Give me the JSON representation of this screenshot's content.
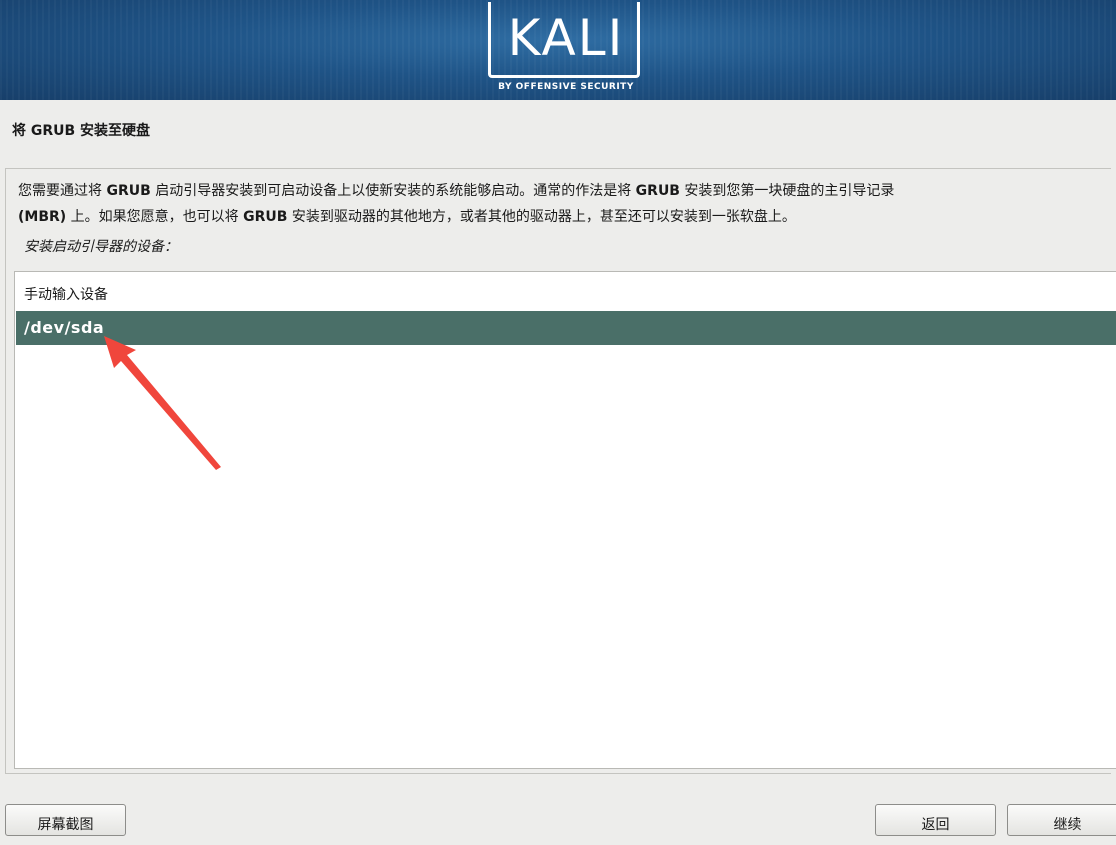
{
  "banner": {
    "logo_text": "KALI",
    "logo_subtitle": "BY OFFENSIVE SECURITY"
  },
  "step": {
    "title": "将 GRUB 安装至硬盘"
  },
  "description": {
    "line1_part1": "您需要通过将 ",
    "line1_bold1": "GRUB",
    "line1_part2": " 启动引导器安装到可启动设备上以使新安装的系统能够启动。通常的作法是将 ",
    "line1_bold2": "GRUB",
    "line1_part3": " 安装到您第一块硬盘的主引导记录",
    "line2_bold1": "(MBR)",
    "line2_part1": " 上。如果您愿意，也可以将 ",
    "line2_bold2": "GRUB",
    "line2_part2": " 安装到驱动器的其他地方，或者其他的驱动器上，甚至还可以安装到一张软盘上。"
  },
  "prompt": "安装启动引导器的设备：",
  "device_list": {
    "items": [
      {
        "label": "手动输入设备",
        "selected": false
      },
      {
        "label": "/dev/sda",
        "selected": true
      }
    ],
    "selected_color": "#4a6f68"
  },
  "annotation": {
    "arrow_color": "#f0463c",
    "arrow_icon": "red-arrow-icon"
  },
  "buttons": {
    "screenshot": "屏幕截图",
    "back": "返回",
    "continue": "继续"
  }
}
